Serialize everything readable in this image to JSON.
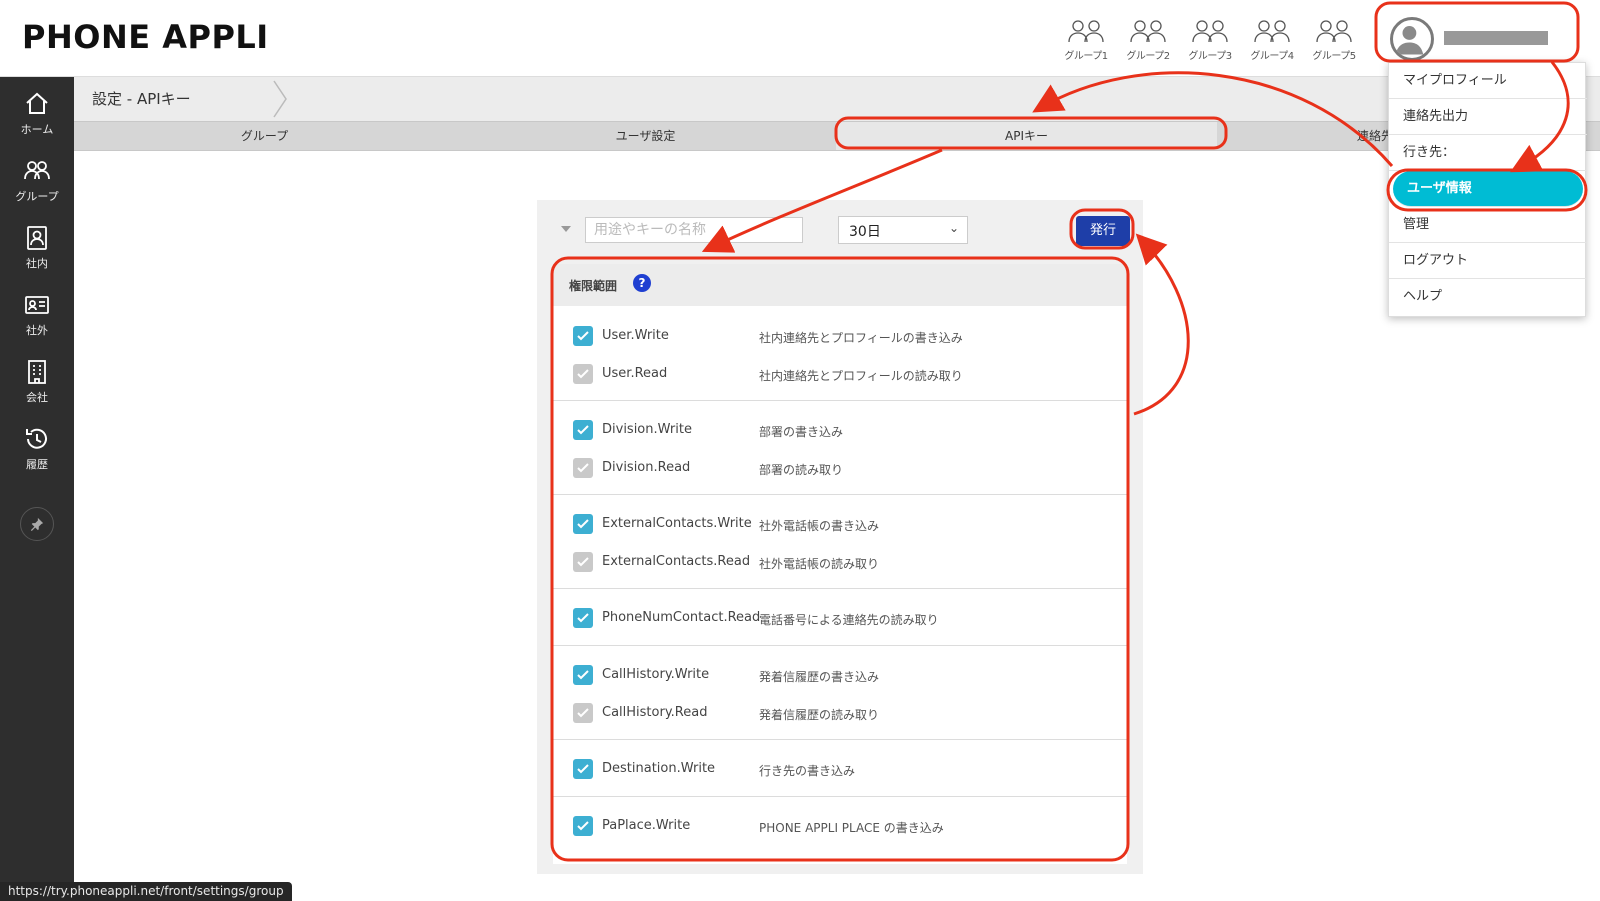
{
  "app": {
    "logo": "PHONE APPLI"
  },
  "header": {
    "groups": [
      {
        "label": "グループ1"
      },
      {
        "label": "グループ2"
      },
      {
        "label": "グループ3"
      },
      {
        "label": "グループ4"
      },
      {
        "label": "グループ5"
      }
    ]
  },
  "sidebar": {
    "items": [
      {
        "label": "ホーム",
        "icon": "home-icon"
      },
      {
        "label": "グループ",
        "icon": "group-icon"
      },
      {
        "label": "社内",
        "icon": "contact-book-icon"
      },
      {
        "label": "社外",
        "icon": "id-card-icon"
      },
      {
        "label": "会社",
        "icon": "building-icon"
      },
      {
        "label": "履歴",
        "icon": "history-icon"
      }
    ],
    "pin_icon": "pin-icon"
  },
  "breadcrumb": {
    "text": "設定 - APIキー"
  },
  "tabs": [
    {
      "label": "グループ"
    },
    {
      "label": "ユーザ設定"
    },
    {
      "label": "APIキー",
      "active": true
    },
    {
      "label": "連絡先ア"
    }
  ],
  "form": {
    "name_placeholder": "用途やキーの名称",
    "period_value": "30日",
    "issue_label": "発行"
  },
  "scope": {
    "title": "権限範囲",
    "help_label": "?",
    "permissions": [
      {
        "key": "User.Write",
        "desc": "社内連絡先とプロフィールの書き込み",
        "checked": true
      },
      {
        "key": "User.Read",
        "desc": "社内連絡先とプロフィールの読み取り",
        "checked": true,
        "disabled": true
      },
      {
        "key": "Division.Write",
        "desc": "部署の書き込み",
        "checked": true
      },
      {
        "key": "Division.Read",
        "desc": "部署の読み取り",
        "checked": true,
        "disabled": true
      },
      {
        "key": "ExternalContacts.Write",
        "desc": "社外電話帳の書き込み",
        "checked": true
      },
      {
        "key": "ExternalContacts.Read",
        "desc": "社外電話帳の読み取り",
        "checked": true,
        "disabled": true
      },
      {
        "key": "PhoneNumContact.Read",
        "desc": "電話番号による連絡先の読み取り",
        "checked": true
      },
      {
        "key": "CallHistory.Write",
        "desc": "発着信履歴の書き込み",
        "checked": true
      },
      {
        "key": "CallHistory.Read",
        "desc": "発着信履歴の読み取り",
        "checked": true,
        "disabled": true
      },
      {
        "key": "Destination.Write",
        "desc": "行き先の書き込み",
        "checked": true
      },
      {
        "key": "PaPlace.Write",
        "desc": "PHONE APPLI PLACE の書き込み",
        "checked": true
      }
    ]
  },
  "user_menu": {
    "items": [
      {
        "label": "マイプロフィール"
      },
      {
        "label": "連絡先出力"
      },
      {
        "label": "行き先："
      },
      {
        "label": "ユーザ情報",
        "active": true
      },
      {
        "label": "管理"
      },
      {
        "label": "ログアウト"
      },
      {
        "label": "ヘルプ"
      }
    ]
  },
  "status": {
    "url": "https://try.phoneappli.net/front/settings/group"
  },
  "colors": {
    "highlight": "#e8311a",
    "accent": "#00bcd4",
    "button": "#1e3ea8",
    "checkbox": "#3dafd2"
  }
}
